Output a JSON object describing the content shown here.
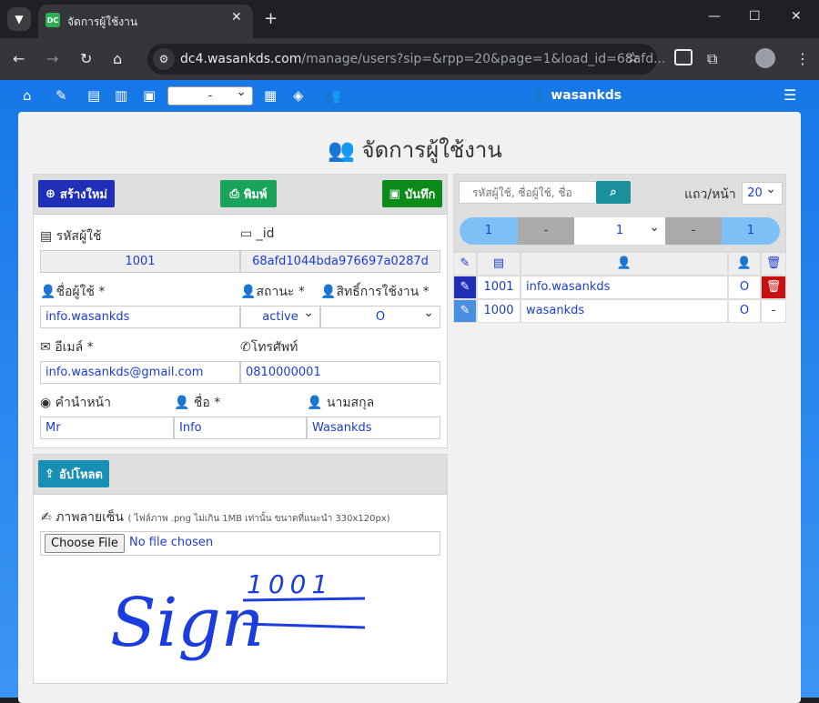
{
  "browser": {
    "tab_title": "จัดการผู้ใช้งาน",
    "favicon_text": "DC",
    "url_host": "dc4.wasankds.com",
    "url_path": "/manage/users?sip=&rpp=20&page=1&load_id=68afd..."
  },
  "nav": {
    "select_value": "-",
    "username": "wasankds"
  },
  "page": {
    "title": "จัดการผู้ใช้งาน"
  },
  "form": {
    "create_label": "สร้างใหม่",
    "print_label": "พิมพ์",
    "save_label": "บันทึก",
    "userid_label": "รหัสผู้ใช้",
    "userid_value": "1001",
    "id_label": "_id",
    "id_value": "68afd1044bda976697a0287d",
    "username_label": "ชื่อผู้ใช้ *",
    "username_value": "info.wasankds",
    "status_label": "สถานะ *",
    "status_value": "active",
    "role_label": "สิทธิ์การใช้งาน *",
    "role_value": "O",
    "email_label": "อีเมล์ *",
    "email_value": "info.wasankds@gmail.com",
    "phone_label": "โทรศัพท์",
    "phone_value": "0810000001",
    "prefix_label": "คำนำหน้า",
    "prefix_value": "Mr",
    "name_label": "ชื่อ *",
    "name_value": "Info",
    "surname_label": "นามสกุล",
    "surname_value": "Wasankds"
  },
  "upload": {
    "button_label": "อัปโหลด",
    "sig_label": "ภาพลายเซ็น",
    "sig_hint": "( ไฟล์ภาพ .png ไม่เกิน 1MB เท่านั้น ขนาดที่แนะนำ 330x120px)",
    "choose_label": "Choose File",
    "nofile_label": "No file chosen",
    "sig_text": "Sign",
    "sig_num": "1001"
  },
  "list": {
    "search_placeholder": "รหัสผู้ใช้, ชื่อผู้ใช้, ชื่อ",
    "rows_label": "แถว/หน้า",
    "rows_value": "20",
    "pager": [
      "1",
      "-",
      "1",
      "-",
      "1"
    ],
    "rows": [
      {
        "id": "1001",
        "username": "info.wasankds",
        "role": "O",
        "del": true
      },
      {
        "id": "1000",
        "username": "wasankds",
        "role": "O",
        "del": false
      }
    ]
  }
}
